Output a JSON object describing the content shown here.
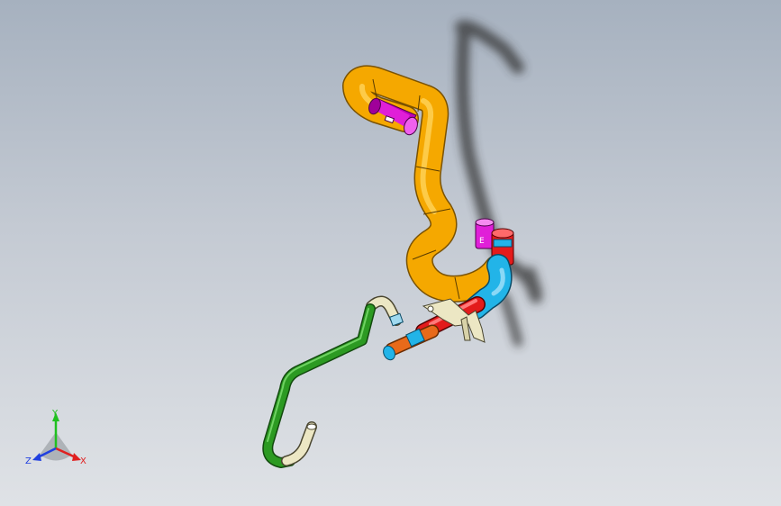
{
  "viewport": {
    "background_top": "#a6b1bf",
    "background_bottom": "#dfe2e6"
  },
  "model": {
    "parts": [
      {
        "name": "yellow-hose",
        "color": "#f5a800"
      },
      {
        "name": "magenta-connector-upper",
        "color": "#e01fd8"
      },
      {
        "name": "magenta-connector-lower",
        "color": "#e01fd8"
      },
      {
        "name": "red-connector",
        "color": "#e31b1b"
      },
      {
        "name": "cyan-elbow",
        "color": "#22b4e8"
      },
      {
        "name": "red-tube",
        "color": "#e31b1b"
      },
      {
        "name": "orange-fitting",
        "color": "#e86a1a"
      },
      {
        "name": "cyan-fitting",
        "color": "#22b4e8"
      },
      {
        "name": "cream-bracket",
        "color": "#ece7c4"
      },
      {
        "name": "green-hose",
        "color": "#2c9a22"
      },
      {
        "name": "cream-end-upper",
        "color": "#ece7c4"
      },
      {
        "name": "cream-end-lower",
        "color": "#ece7c4"
      }
    ]
  },
  "triad": {
    "x_label": "X",
    "y_label": "Y",
    "z_label": "Z",
    "x_color": "#e02020",
    "y_color": "#20c020",
    "z_color": "#2040e0"
  }
}
